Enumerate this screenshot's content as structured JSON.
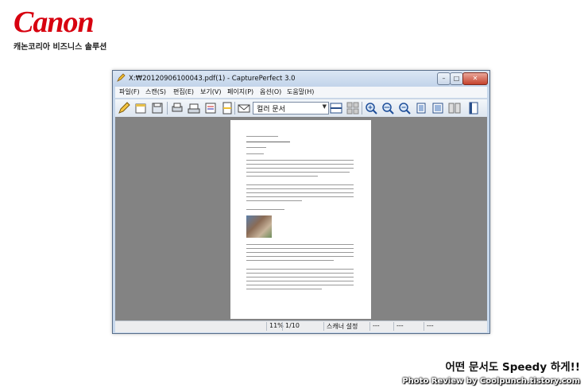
{
  "brand": {
    "logo": "Canon",
    "tagline": "캐논코리아 비즈니스 솔루션",
    "logo_color": "#d7000f"
  },
  "window": {
    "title": "X:₩20120906100043.pdf(1) - CapturePerfect 3.0",
    "buttons": {
      "minimize": "–",
      "maximize": "□",
      "close": "✕"
    }
  },
  "menu": [
    "파일(F)",
    "스캔(S)",
    "편집(E)",
    "보기(V)",
    "페이지(P)",
    "옵션(O)",
    "도움말(H)"
  ],
  "toolbar": {
    "icons": [
      "edit-pen-icon",
      "open-folder-icon",
      "save-icon",
      "print-icon",
      "scan-icon",
      "scan-batch-icon",
      "scan-page-icon",
      "email-icon",
      "scanner-settings-icon",
      "split-view-icon",
      "thumbnail-view-icon",
      "zoom-in-icon",
      "fit-width-icon",
      "zoom-out-icon",
      "rotate-page-icon",
      "fit-page-icon",
      "page-layout-icon",
      "book-icon"
    ],
    "profile_value": "컬러 문서"
  },
  "status": {
    "zoom": "11%",
    "page": "1/10",
    "scanner": "스캐너 설정",
    "f1": "---",
    "f2": "---",
    "f3": "---"
  },
  "caption": "어떤 문서도 Speedy 하게!!",
  "credit": "Photo Review by Coolpunch.tistory.com"
}
